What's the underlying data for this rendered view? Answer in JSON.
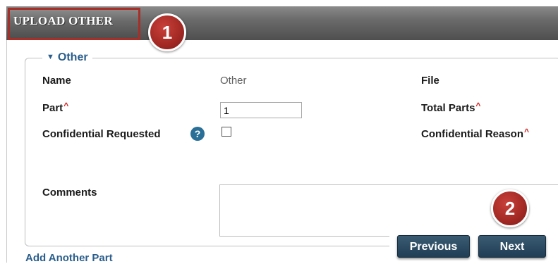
{
  "header": {
    "title": "UPLOAD OTHER"
  },
  "callouts": [
    "1",
    "2"
  ],
  "section": {
    "legend": "Other",
    "fields": {
      "name_label": "Name",
      "name_value": "Other",
      "file_label": "File",
      "part_label": "Part",
      "part_value": "1",
      "total_parts_label": "Total Parts",
      "confidential_requested_label": "Confidential Requested",
      "confidential_reason_label": "Confidential Reason",
      "comments_label": "Comments",
      "required_marker": "^",
      "help_glyph": "?"
    }
  },
  "actions": {
    "previous_label": "Previous",
    "next_label": "Next",
    "add_part_label": "Add Another Part"
  },
  "colors": {
    "header": "#5f5f5f",
    "callout": "#a52a25",
    "accent": "#2a5e8c",
    "button": "#2b4a61"
  }
}
